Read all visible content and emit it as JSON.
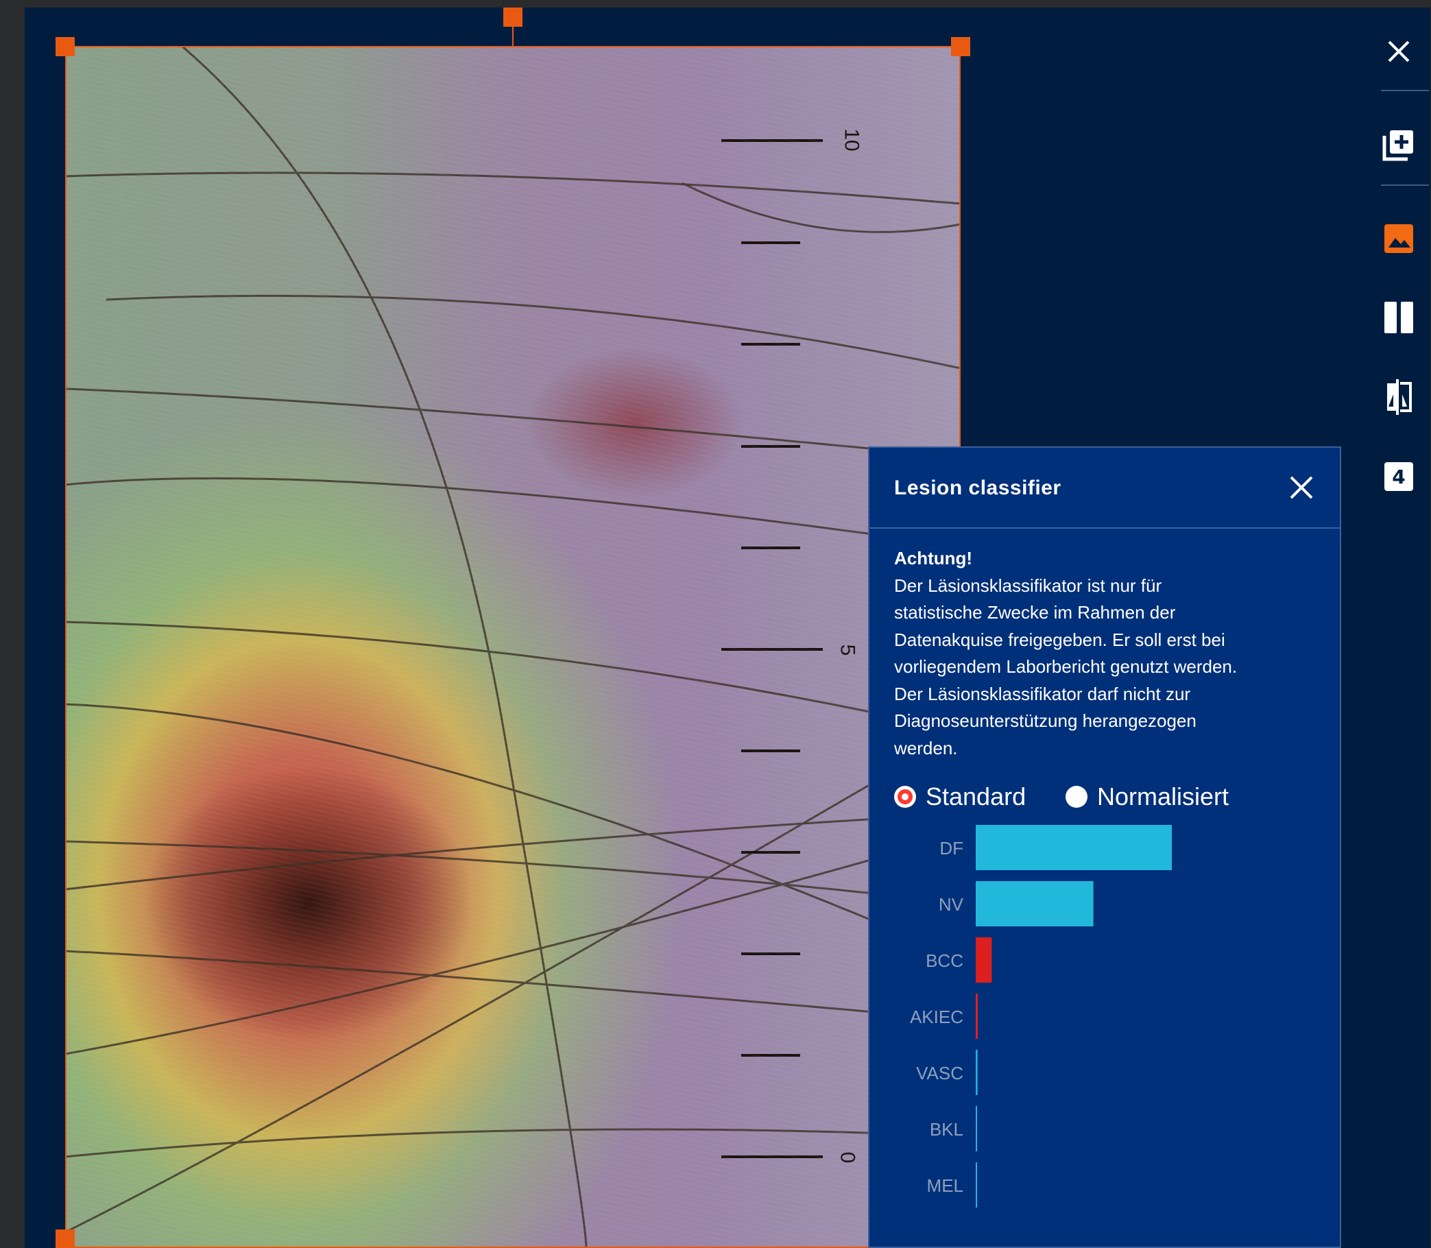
{
  "panel": {
    "title": "Lesion classifier",
    "warning_title": "Achtung!",
    "warning_lines": [
      "Der Läsionsklassifikator ist nur für",
      "statistische Zwecke im Rahmen der",
      "Datenakquise freigegeben. Er soll erst bei",
      "vorliegendem Laborbericht genutzt werden.",
      "Der Läsionsklassifikator darf nicht zur",
      "Diagnoseunterstützung herangezogen",
      "werden."
    ],
    "radio": {
      "options": [
        "Standard",
        "Normalisiert"
      ],
      "selected": "Standard"
    }
  },
  "ruler": {
    "labels": [
      "10",
      "5",
      "0"
    ]
  },
  "toolbar": {
    "icons": [
      "close-icon",
      "add-image-icon",
      "image-icon",
      "split-view-icon",
      "compare-icon",
      "four-view-icon"
    ],
    "active": "image-icon",
    "four_view_label": "4"
  },
  "colors": {
    "accent": "#e85a12",
    "panel_bg": "#00307a",
    "app_bg": "#001d40",
    "bar_cyan": "#22b8dc",
    "bar_red": "#dc2020"
  },
  "chart_data": {
    "type": "bar",
    "orientation": "horizontal",
    "categories": [
      "DF",
      "NV",
      "BCC",
      "AKIEC",
      "VASC",
      "BKL",
      "MEL"
    ],
    "values": [
      0.55,
      0.33,
      0.045,
      0.006,
      0.005,
      0.002,
      0.001
    ],
    "bar_colors": [
      "#22b8dc",
      "#22b8dc",
      "#dc2020",
      "#dc2020",
      "#22b8dc",
      "#22b8dc",
      "#22b8dc"
    ],
    "xlim": [
      0,
      1
    ],
    "title": "",
    "xlabel": "",
    "ylabel": ""
  }
}
